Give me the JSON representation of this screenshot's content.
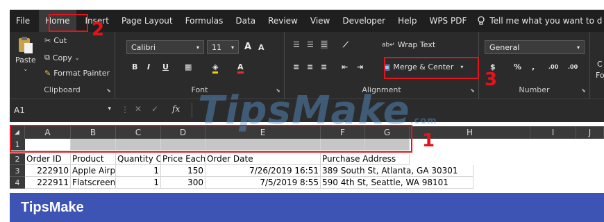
{
  "tabs": [
    "File",
    "Home",
    "Insert",
    "Page Layout",
    "Formulas",
    "Data",
    "Review",
    "View",
    "Developer",
    "Help",
    "WPS PDF"
  ],
  "tell_me": "Tell me what you want to d",
  "clipboard": {
    "paste": "Paste",
    "cut": "Cut",
    "copy": "Copy",
    "format_painter": "Format Painter",
    "label": "Clipboard"
  },
  "font": {
    "name": "Calibri",
    "size": "11",
    "grow": "A",
    "shrink": "A",
    "bold": "B",
    "italic": "I",
    "underline": "U",
    "label": "Font",
    "fill_letter": "A"
  },
  "alignment": {
    "wrap_text": "Wrap Text",
    "merge_center": "Merge & Center",
    "label": "Alignment"
  },
  "number": {
    "format": "General",
    "currency": "$",
    "percent": "%",
    "comma": ",",
    "inc_dec": ".00",
    "dec_dec": ".00",
    "label": "Number"
  },
  "overflow": {
    "a": "C",
    "b": "Fo"
  },
  "formula_bar": {
    "name_box": "A1",
    "fx": "fx"
  },
  "columns": [
    "A",
    "B",
    "C",
    "D",
    "E",
    "F",
    "G",
    "H",
    "I",
    "J"
  ],
  "rows": [
    {
      "num": "1",
      "cells": [
        "",
        "",
        "",
        "",
        "",
        "",
        ""
      ]
    },
    {
      "num": "2",
      "cells": [
        "Order ID",
        "Product",
        "Quantity C",
        "Price Each",
        "Order Date",
        "Purchase Address",
        ""
      ]
    },
    {
      "num": "3",
      "cells": [
        "222910",
        "Apple Airp",
        "1",
        "150",
        "7/26/2019 16:51",
        "389 South St, Atlanta, GA 30301",
        ""
      ]
    },
    {
      "num": "4",
      "cells": [
        "222911",
        "Flatscreen",
        "1",
        "300",
        "7/5/2019 8:55",
        "590 4th St, Seattle, WA 98101",
        ""
      ]
    }
  ],
  "footer": "TipsMake",
  "watermark": {
    "text": "TipsMake",
    "suffix": ".com"
  },
  "annotations": [
    "1",
    "2",
    "3"
  ],
  "colors": {
    "accent_red": "#e8121a",
    "footer_blue": "#3d54b4",
    "ribbon_dark": "#2b2b2b"
  }
}
